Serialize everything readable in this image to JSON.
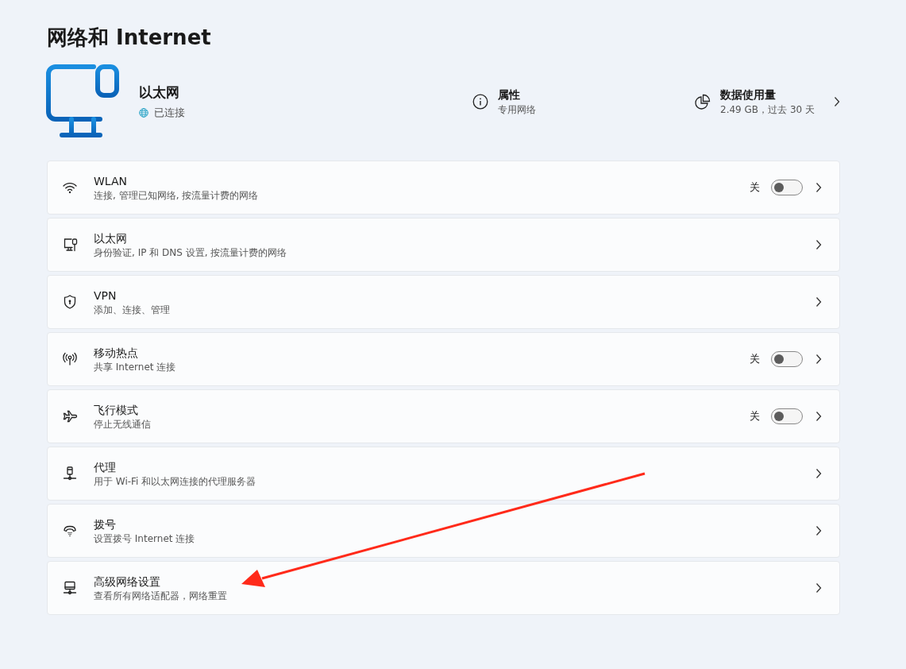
{
  "page_title": "网络和 Internet",
  "connection": {
    "name": "以太网",
    "status": "已连接",
    "properties": {
      "title": "属性",
      "subtitle": "专用网络"
    },
    "data_usage": {
      "title": "数据使用量",
      "subtitle": "2.49 GB，过去 30 天"
    }
  },
  "rows": [
    {
      "kind": "toggle",
      "title": "WLAN",
      "subtitle": "连接, 管理已知网络, 按流量计费的网络",
      "toggle_label": "关",
      "on": false
    },
    {
      "kind": "link",
      "title": "以太网",
      "subtitle": "身份验证, IP 和 DNS 设置, 按流量计费的网络"
    },
    {
      "kind": "link",
      "title": "VPN",
      "subtitle": "添加、连接、管理"
    },
    {
      "kind": "toggle",
      "title": "移动热点",
      "subtitle": "共享 Internet 连接",
      "toggle_label": "关",
      "on": false
    },
    {
      "kind": "toggle",
      "title": "飞行模式",
      "subtitle": "停止无线通信",
      "toggle_label": "关",
      "on": false
    },
    {
      "kind": "link",
      "title": "代理",
      "subtitle": "用于 Wi-Fi 和以太网连接的代理服务器"
    },
    {
      "kind": "link",
      "title": "拨号",
      "subtitle": "设置拨号 Internet 连接"
    },
    {
      "kind": "link",
      "title": "高级网络设置",
      "subtitle": "查看所有网络适配器，网络重置"
    }
  ],
  "annotations": [
    {
      "kind": "arrow"
    }
  ]
}
